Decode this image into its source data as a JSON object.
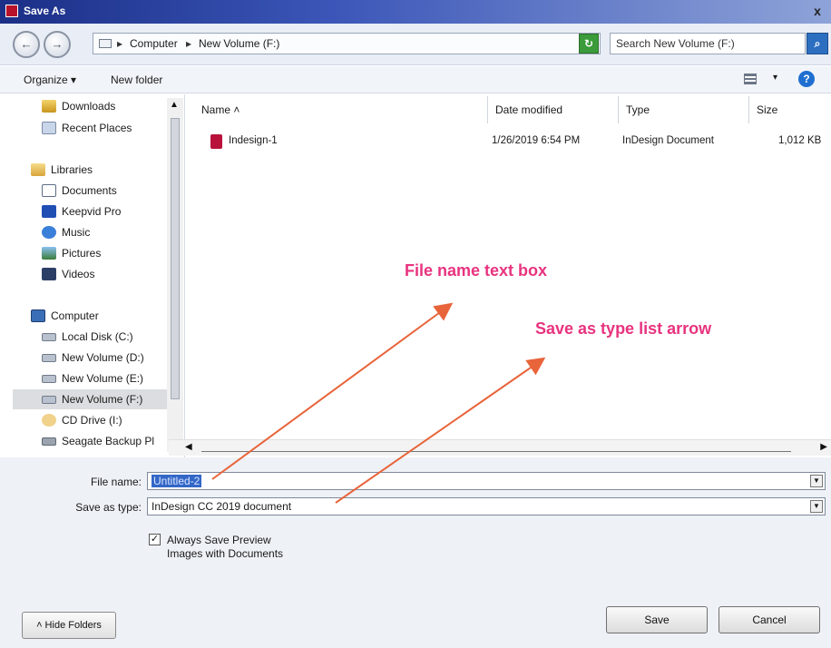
{
  "window": {
    "title": "Save As",
    "close_label": "x"
  },
  "address_bar": {
    "back_label": "←",
    "forward_label": "→",
    "breadcrumbs": [
      "Computer",
      "New Volume (F:)"
    ],
    "separator": "▸",
    "dropdown_label": "▾",
    "refresh_label": "↻",
    "search_placeholder": "Search New Volume (F:)",
    "search_button_label": "⌕"
  },
  "toolbar": {
    "organize_label": "Organize ▾",
    "new_folder_label": "New folder",
    "view_dropdown_label": "▾",
    "help_label": "?"
  },
  "sidebar": {
    "favorites": [
      {
        "label": "Downloads",
        "icon": "downloads-icon"
      },
      {
        "label": "Recent Places",
        "icon": "recent-places-icon"
      }
    ],
    "libraries": [
      {
        "label": "Libraries",
        "icon": "libraries-icon"
      },
      {
        "label": "Documents",
        "icon": "documents-icon"
      },
      {
        "label": "Keepvid Pro",
        "icon": "keepvid-icon"
      },
      {
        "label": "Music",
        "icon": "music-icon"
      },
      {
        "label": "Pictures",
        "icon": "pictures-icon"
      },
      {
        "label": "Videos",
        "icon": "videos-icon"
      }
    ],
    "computer": [
      {
        "label": "Computer",
        "icon": "computer-icon"
      },
      {
        "label": "Local Disk (C:)",
        "icon": "drive-icon"
      },
      {
        "label": "New Volume (D:)",
        "icon": "drive-icon"
      },
      {
        "label": "New Volume (E:)",
        "icon": "drive-icon"
      },
      {
        "label": "New Volume (F:)",
        "icon": "drive-icon",
        "selected": true
      },
      {
        "label": "CD Drive (I:)",
        "icon": "cd-drive-icon"
      },
      {
        "label": "Seagate Backup Pl",
        "icon": "external-drive-icon"
      }
    ]
  },
  "file_list": {
    "columns": [
      "Name",
      "Date modified",
      "Type",
      "Size"
    ],
    "sort_indicator": "˄",
    "rows": [
      {
        "name": "Indesign-1",
        "date_modified": "1/26/2019 6:54 PM",
        "type": "InDesign Document",
        "size": "1,012 KB"
      }
    ]
  },
  "form": {
    "file_name_label": "File name:",
    "file_name_value": "Untitled-2",
    "save_as_type_label": "Save as type:",
    "save_as_type_value": "InDesign CC 2019 document",
    "checkbox_checked": true,
    "checkbox_label_line1": "Always Save Preview",
    "checkbox_label_line2": "Images with Documents",
    "hide_folders_label": "˄ Hide Folders",
    "save_label": "Save",
    "cancel_label": "Cancel"
  },
  "annotations": {
    "file_name_text_box": "File name text box",
    "save_as_type_arrow": "Save as type list arrow",
    "color": "#e8337f",
    "arrow_color": "#e8643a"
  }
}
